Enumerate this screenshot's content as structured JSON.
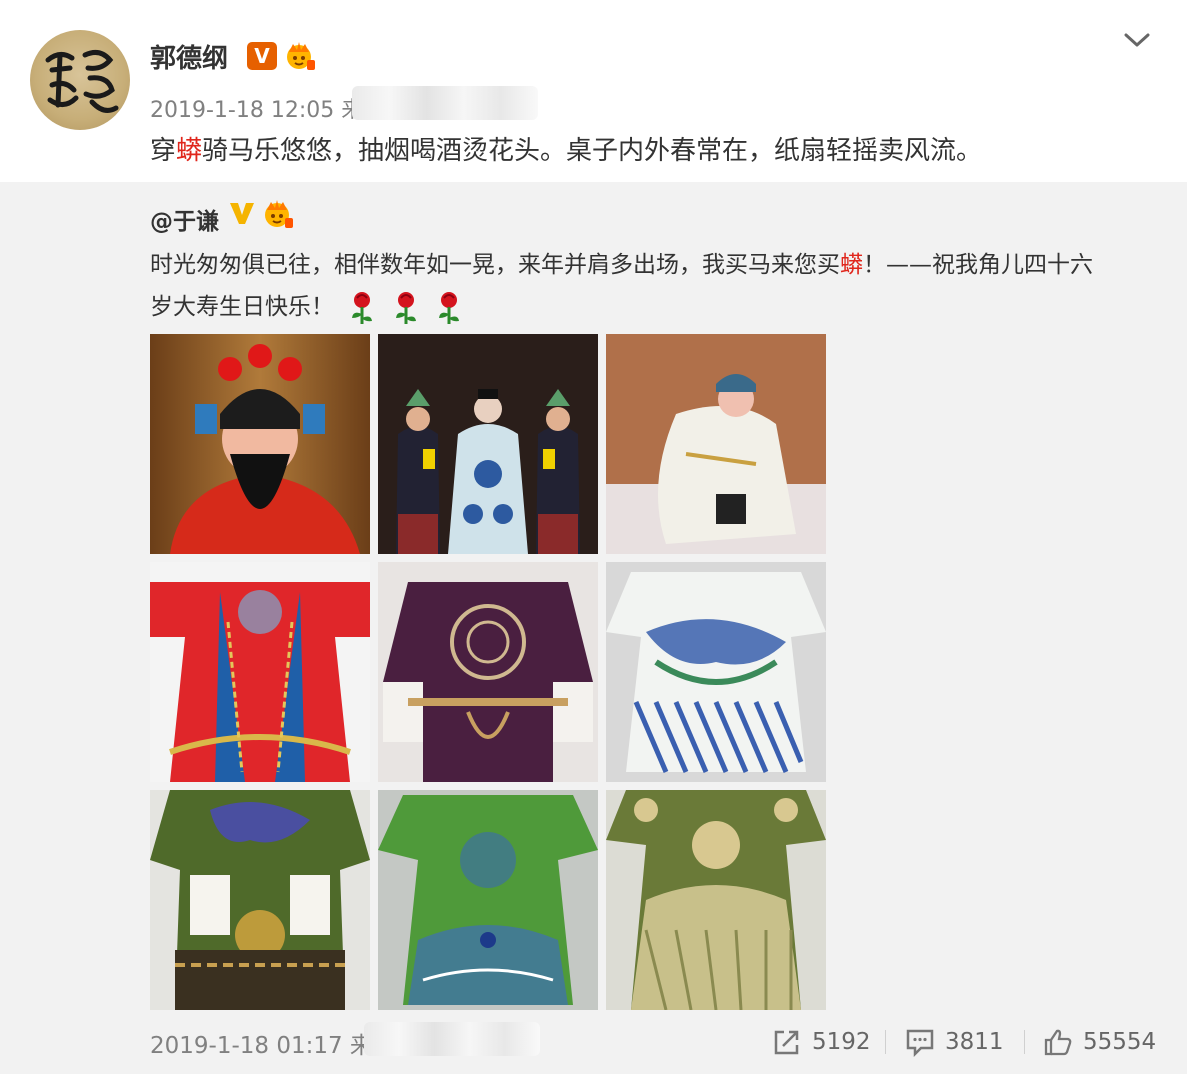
{
  "post": {
    "username": "郭德纲",
    "verified_badge": "V",
    "timestamp": "2019-1-18 12:05 来自",
    "text_prefix": "穿",
    "text_highlight": "蟒",
    "text_suffix": "骑马乐悠悠，抽烟喝酒烫花头。桌子内外春常在，纸扇轻摇卖风流。",
    "avatar_calligraphy": "郭"
  },
  "repost": {
    "username": "@于谦",
    "line1_prefix": "时光匆匆俱已往，相伴数年如一晃，来年并肩多出场，我买马来您买",
    "line1_highlight": "蟒",
    "line1_suffix": "！——祝我角儿四十六",
    "line2": "岁大寿生日快乐！",
    "timestamp": "2019-1-18 01:17 来自",
    "images": [
      {
        "name": "photo-opera-general",
        "icon": "opera-performer"
      },
      {
        "name": "photo-stage-trio",
        "icon": "opera-performers"
      },
      {
        "name": "photo-white-robe-performer",
        "icon": "opera-performer"
      },
      {
        "name": "photo-red-robe",
        "icon": "costume"
      },
      {
        "name": "photo-purple-robe",
        "icon": "costume"
      },
      {
        "name": "photo-blue-dragon-robe",
        "icon": "costume"
      },
      {
        "name": "photo-green-robe-1",
        "icon": "costume"
      },
      {
        "name": "photo-green-robe-2",
        "icon": "costume"
      },
      {
        "name": "photo-green-gold-robe",
        "icon": "costume"
      }
    ],
    "actions": {
      "forward_count": "5192",
      "comment_count": "3811",
      "like_count": "55554"
    }
  },
  "colors": {
    "accent_red": "#e0261c",
    "verified_orange": "#e66000",
    "verified_gold": "#f5b400",
    "repost_bg": "#f2f2f2"
  }
}
